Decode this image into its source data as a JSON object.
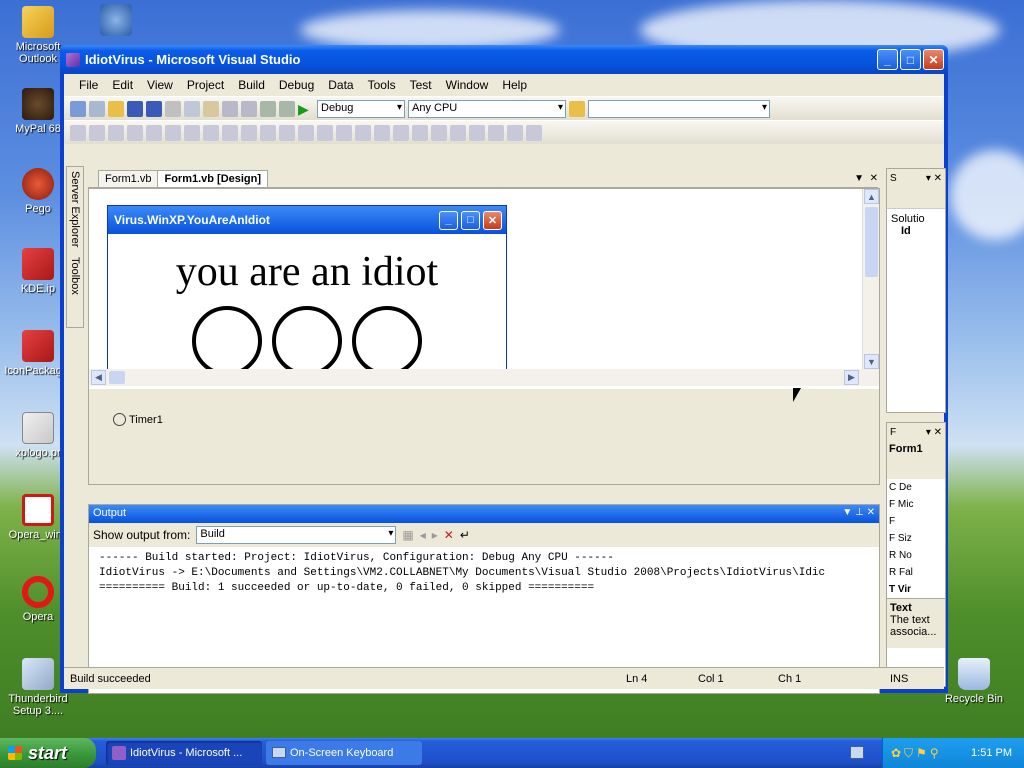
{
  "desktop": {
    "icons": [
      {
        "label": "Microsoft Outlook"
      },
      {
        "label": "MyPal 68"
      },
      {
        "label": "Pego"
      },
      {
        "label": "KDE.ip"
      },
      {
        "label": "IconPackager"
      },
      {
        "label": "xplogo.pr"
      },
      {
        "label": "Opera_winx"
      },
      {
        "label": "Opera"
      },
      {
        "label": "Thunderbird Setup 3...."
      },
      {
        "label": "Recycle Bin"
      }
    ]
  },
  "window": {
    "title": "IdiotVirus - Microsoft Visual Studio",
    "menu": [
      "File",
      "Edit",
      "View",
      "Project",
      "Build",
      "Debug",
      "Data",
      "Tools",
      "Test",
      "Window",
      "Help"
    ],
    "toolbar": {
      "config": "Debug",
      "platform": "Any CPU"
    },
    "side_tabs": {
      "server_explorer": "Server Explorer",
      "toolbox": "Toolbox"
    },
    "doc_tabs": [
      {
        "label": "Form1.vb"
      },
      {
        "label": "Form1.vb [Design]"
      }
    ],
    "form": {
      "title": "Virus.WinXP.YouAreAnIdiot",
      "text": "you are an idiot"
    },
    "component_tray": {
      "timer": "Timer1"
    },
    "output": {
      "title": "Output",
      "show_from_label": "Show output from:",
      "show_from_value": "Build",
      "lines": [
        "------ Build started: Project: IdiotVirus, Configuration: Debug Any CPU ------",
        "IdiotVirus -> E:\\Documents and Settings\\VM2.COLLABNET\\My Documents\\Visual Studio 2008\\Projects\\IdiotVirus\\Idic",
        "========== Build: 1 succeeded or up-to-date, 0 failed, 0 skipped =========="
      ]
    },
    "solution_panel": {
      "title": "S",
      "item1": "Solutio",
      "item2": "Id"
    },
    "properties_panel": {
      "title": "F",
      "object": "Form1",
      "rows": [
        "C De",
        "F Mic",
        "F",
        "F Siz",
        "R No",
        "R Fal",
        "T Vir"
      ],
      "desc_title": "Text",
      "desc": "The text associa..."
    },
    "status": {
      "message": "Build succeeded",
      "ln": "Ln 4",
      "col": "Col 1",
      "ch": "Ch 1",
      "mode": "INS"
    }
  },
  "taskbar": {
    "start": "start",
    "tasks": [
      {
        "label": "IdiotVirus - Microsoft ..."
      },
      {
        "label": "On-Screen Keyboard"
      }
    ],
    "clock": "1:51 PM"
  }
}
